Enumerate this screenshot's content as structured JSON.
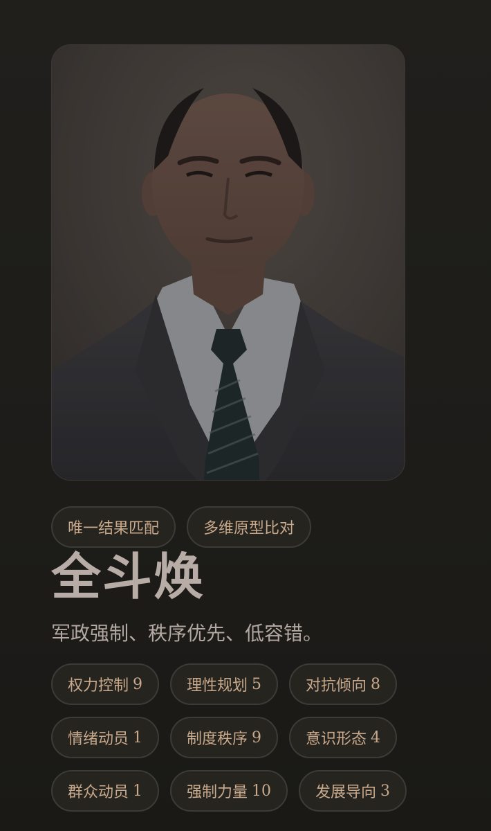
{
  "card": {
    "badges": [
      {
        "label": "唯一结果匹配"
      },
      {
        "label": "多维原型比对"
      }
    ],
    "name": "全斗焕",
    "description": "军政强制、秩序优先、低容错。",
    "traits": [
      {
        "label": "权力控制",
        "score": "9"
      },
      {
        "label": "理性规划",
        "score": "5"
      },
      {
        "label": "对抗倾向",
        "score": "8"
      },
      {
        "label": "情绪动员",
        "score": "1"
      },
      {
        "label": "制度秩序",
        "score": "9"
      },
      {
        "label": "意识形态",
        "score": "4"
      },
      {
        "label": "群众动员",
        "score": "1"
      },
      {
        "label": "强制力量",
        "score": "10"
      },
      {
        "label": "发展导向",
        "score": "3"
      }
    ]
  },
  "colors": {
    "background": "#1c1b18",
    "pill_background": "#26241f",
    "pill_border": "#3d3b37",
    "pill_text": "#c9a98c",
    "title_text": "#b8aca6",
    "subtitle_text": "#b3a8a2"
  },
  "icons": {
    "portrait": "portrait-photo"
  }
}
